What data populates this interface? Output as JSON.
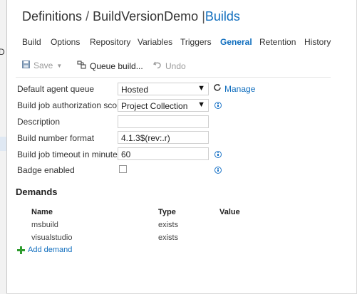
{
  "left_rail": {
    "edge_glyph": "D"
  },
  "header": {
    "definitions": "Definitions",
    "separator": "/",
    "definition_name": "BuildVersionDemo",
    "divider": "|",
    "builds_link": "Builds"
  },
  "tabs": [
    {
      "label": "Build",
      "active": false
    },
    {
      "label": "Options",
      "active": false
    },
    {
      "label": "Repository",
      "active": false
    },
    {
      "label": "Variables",
      "active": false
    },
    {
      "label": "Triggers",
      "active": false
    },
    {
      "label": "General",
      "active": true
    },
    {
      "label": "Retention",
      "active": false
    },
    {
      "label": "History",
      "active": false
    }
  ],
  "toolbar": {
    "save_label": "Save",
    "queue_label": "Queue build...",
    "undo_label": "Undo"
  },
  "form": {
    "agent_queue_label": "Default agent queue",
    "agent_queue_value": "Hosted",
    "manage_label": "Manage",
    "auth_scope_label": "Build job authorization scope",
    "auth_scope_value": "Project Collection",
    "description_label": "Description",
    "description_value": "",
    "number_format_label": "Build number format",
    "number_format_value": "4.1.3$(rev:.r)",
    "timeout_label": "Build job timeout in minutes",
    "timeout_value": "60",
    "badge_label": "Badge enabled",
    "badge_checked": false
  },
  "demands": {
    "heading": "Demands",
    "columns": [
      "Name",
      "Type",
      "Value"
    ],
    "rows": [
      {
        "name": "msbuild",
        "type": "exists",
        "value": ""
      },
      {
        "name": "visualstudio",
        "type": "exists",
        "value": ""
      }
    ],
    "add_label": "Add demand"
  },
  "colors": {
    "link": "#106ebe",
    "add_icon": "#2e9b2e",
    "info_icon": "#1a73c7"
  }
}
